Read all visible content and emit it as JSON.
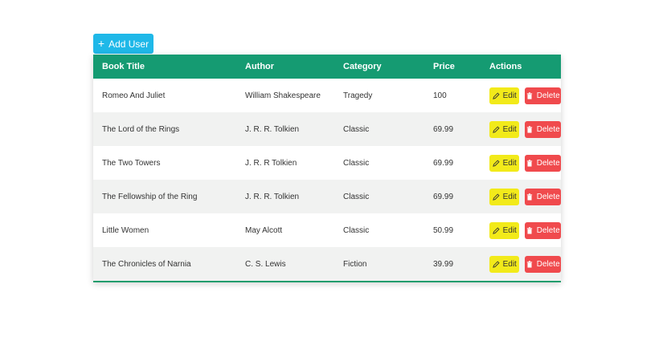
{
  "toolbar": {
    "add_user_label": "Add User"
  },
  "table": {
    "headers": {
      "title": "Book Title",
      "author": "Author",
      "category": "Category",
      "price": "Price",
      "actions": "Actions"
    },
    "rows": [
      {
        "title": "Romeo And Juliet",
        "author": "William Shakespeare",
        "category": "Tragedy",
        "price": "100"
      },
      {
        "title": "The Lord of the Rings",
        "author": "J. R. R. Tolkien",
        "category": "Classic",
        "price": "69.99"
      },
      {
        "title": "The Two Towers",
        "author": "J. R. R Tolkien",
        "category": "Classic",
        "price": "69.99"
      },
      {
        "title": "The Fellowship of the Ring",
        "author": "J. R. R. Tolkien",
        "category": "Classic",
        "price": "69.99"
      },
      {
        "title": "Little Women",
        "author": "May Alcott",
        "category": "Classic",
        "price": "50.99"
      },
      {
        "title": "The Chronicles of Narnia",
        "author": "C. S. Lewis",
        "category": "Fiction",
        "price": "39.99"
      }
    ],
    "edit_label": "Edit",
    "delete_label": "Delete"
  },
  "colors": {
    "header_bg": "#159b72",
    "add_button": "#1fb8e8",
    "edit_button": "#f2ea1a",
    "delete_button": "#f04a4d"
  },
  "icons": {
    "add": "plus-icon",
    "edit": "pencil-icon",
    "delete": "trash-icon"
  }
}
